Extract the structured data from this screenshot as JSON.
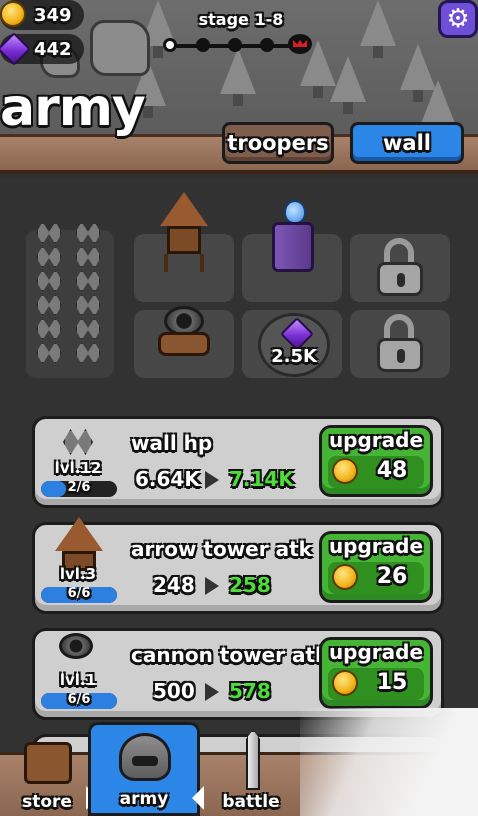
{
  "currency": {
    "coins": "349",
    "gems": "442"
  },
  "stage": {
    "label": "stage 1-8",
    "nodes_total": 5,
    "current_node": 1
  },
  "page_title": "army",
  "tabs": [
    {
      "label": "troopers",
      "active": false
    },
    {
      "label": "wall",
      "active": true
    }
  ],
  "buildings": {
    "gem_unlock_price": "2.5K"
  },
  "upgrades": [
    {
      "title": "wall hp",
      "level": "lvl.12",
      "progress_text": "2/6",
      "progress": 0.333,
      "current": "6.64K",
      "next": "7.14K",
      "button_label": "upgrade",
      "price": "48",
      "icon": "spike-wall-icon"
    },
    {
      "title": "arrow tower atk",
      "level": "lvl.3",
      "progress_text": "6/6",
      "progress": 1.0,
      "current": "248",
      "next": "258",
      "button_label": "upgrade",
      "price": "26",
      "icon": "arrow-tower-icon"
    },
    {
      "title": "cannon tower atk",
      "level": "lvl.1",
      "progress_text": "6/6",
      "progress": 1.0,
      "current": "500",
      "next": "578",
      "button_label": "upgrade",
      "price": "15",
      "icon": "cannon-icon"
    }
  ],
  "nav": {
    "store": "store",
    "army": "army",
    "battle": "battle"
  },
  "colors": {
    "accent_blue": "#2c86e8",
    "upgrade_green": "#46b535",
    "next_value_green": "#4ddc3a"
  }
}
